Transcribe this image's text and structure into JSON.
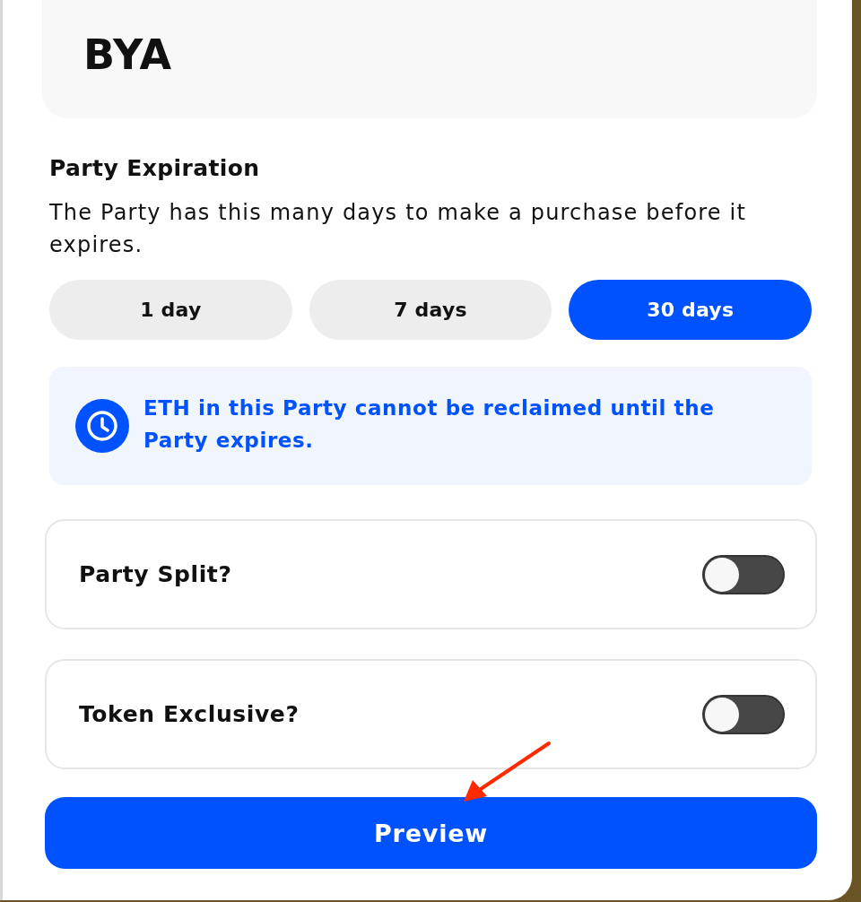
{
  "header": {
    "title": "BYA"
  },
  "expiration": {
    "title": "Party Expiration",
    "description": "The Party has this many days to make a purchase before it expires.",
    "options": [
      {
        "label": "1 day",
        "selected": false
      },
      {
        "label": "7 days",
        "selected": false
      },
      {
        "label": "30 days",
        "selected": true
      }
    ]
  },
  "notice": {
    "text": "ETH in this Party cannot be reclaimed until the Party expires."
  },
  "toggles": [
    {
      "label": "Party Split?",
      "on": false
    },
    {
      "label": "Token Exclusive?",
      "on": false
    }
  ],
  "primary_button": {
    "label": "Preview"
  },
  "annotation": {
    "kind": "arrow"
  }
}
